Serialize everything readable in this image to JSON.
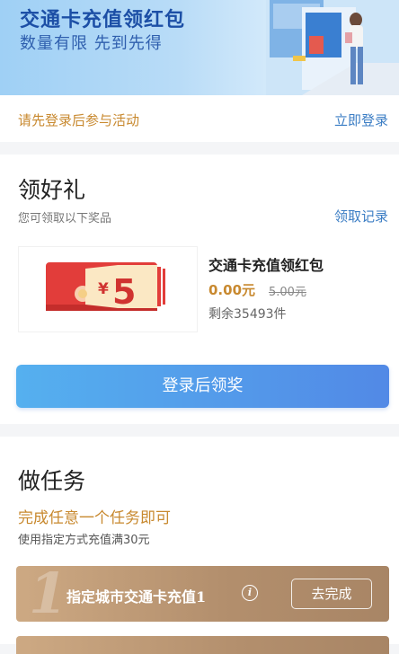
{
  "banner": {
    "title": "交通卡充值领红包",
    "subtitle": "数量有限 先到先得"
  },
  "login_bar": {
    "tip": "请先登录后参与活动",
    "link_label": "立即登录"
  },
  "gift": {
    "title": "领好礼",
    "desc": "您可领取以下奖品",
    "record_label": "领取记录",
    "prize": {
      "amount": "5",
      "currency_symbol": "¥",
      "name": "交通卡充值领红包",
      "price": "0.00元",
      "original_price": "5.00元",
      "remaining": "剩余35493件"
    },
    "claim_button": "登录后领奖"
  },
  "tasks": {
    "title": "做任务",
    "hint": "完成任意一个任务即可",
    "rule": "使用指定方式充值满30元",
    "items": [
      {
        "index": "1",
        "name": "指定城市交通卡充值1",
        "action_label": "去完成"
      }
    ]
  },
  "colors": {
    "accent_blue": "#3b7dc4",
    "accent_gold": "#c8892f",
    "button_gradient_start": "#55b0ef",
    "button_gradient_end": "#5289e6",
    "card_brown": "#b38f6d"
  },
  "icons": {
    "info": "info-icon"
  }
}
